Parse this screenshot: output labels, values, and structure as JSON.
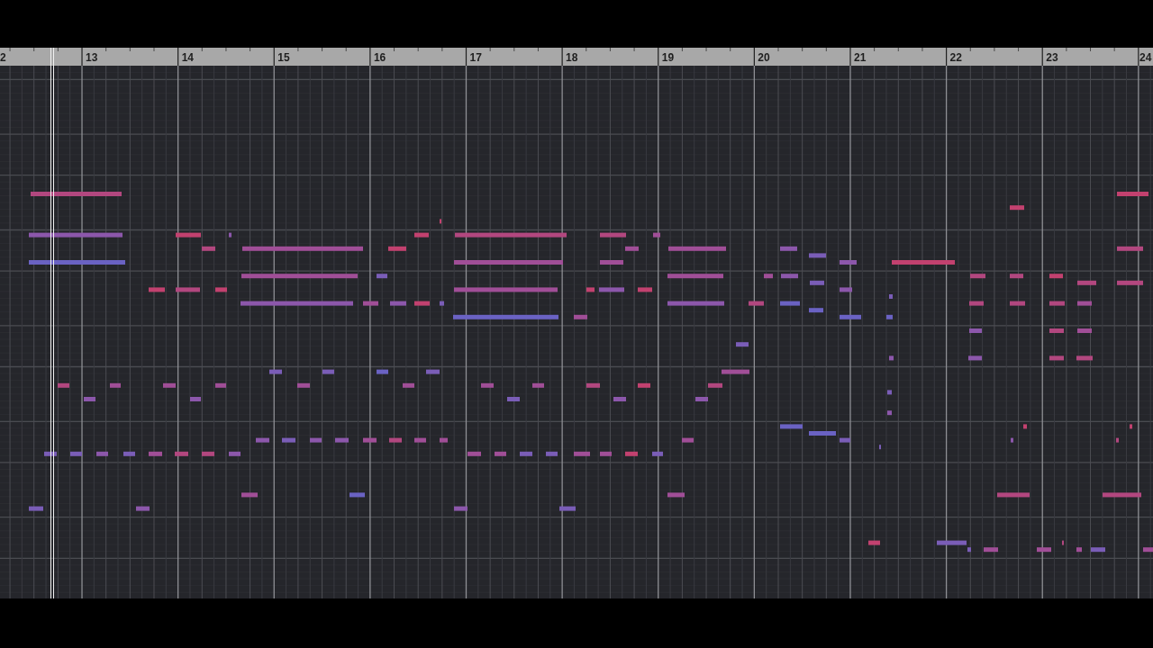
{
  "ruler": {
    "bar_numbers": [
      "2",
      "13",
      "14",
      "15",
      "16",
      "17",
      "18",
      "19",
      "20",
      "21",
      "22",
      "23",
      "24"
    ]
  },
  "notes": [
    {
      "color": "#b2477f"
    },
    {
      "color": "#8c57ab"
    },
    {
      "color": "#6a62c3"
    },
    {
      "color": "#c2416f"
    },
    {
      "color": "#8c57ab"
    },
    {
      "color": "#b2477f"
    },
    {
      "color": "#a04e97"
    },
    {
      "color": "#a04e97"
    },
    {
      "color": "#7a5db7"
    },
    {
      "color": "#c2416f"
    },
    {
      "color": "#b2477f"
    },
    {
      "color": "#c2416f"
    },
    {
      "color": "#8c57ab"
    },
    {
      "color": "#a04e97"
    },
    {
      "color": "#c2416f"
    },
    {
      "color": "#c2416f"
    },
    {
      "color": "#b2477f"
    },
    {
      "color": "#b2477f"
    },
    {
      "color": "#a04e97"
    },
    {
      "color": "#c2416f"
    },
    {
      "color": "#a04e97"
    },
    {
      "color": "#a04e97"
    },
    {
      "color": "#a04e97"
    },
    {
      "color": "#a04e97"
    },
    {
      "color": "#a04e97"
    },
    {
      "color": "#a04e97"
    },
    {
      "color": "#a04e97"
    },
    {
      "color": "#c2416f"
    },
    {
      "color": "#8c57ab"
    },
    {
      "color": "#c2416f"
    },
    {
      "color": "#8c57ab"
    },
    {
      "color": "#c2416f"
    },
    {
      "color": "#7a5db7"
    },
    {
      "color": "#8c57ab"
    },
    {
      "color": "#b2477f"
    },
    {
      "color": "#c2416f"
    },
    {
      "color": "#c2416f"
    },
    {
      "color": "#8c57ab"
    },
    {
      "color": "#b2477f"
    },
    {
      "color": "#7a5db7"
    },
    {
      "color": "#8c57ab"
    },
    {
      "color": "#c2416f"
    },
    {
      "color": "#8c57ab"
    },
    {
      "color": "#b2477f"
    },
    {
      "color": "#b2477f"
    },
    {
      "color": "#c2416f"
    },
    {
      "color": "#7a5db7"
    },
    {
      "color": "#b2477f"
    },
    {
      "color": "#b2477f"
    },
    {
      "color": "#8c57ab"
    },
    {
      "color": "#7a5db7"
    },
    {
      "color": "#6a62c3"
    },
    {
      "color": "#b2477f"
    },
    {
      "color": "#b2477f"
    },
    {
      "color": "#b2477f"
    },
    {
      "color": "#a04e97"
    },
    {
      "color": "#6a62c3"
    },
    {
      "color": "#7a5db7"
    },
    {
      "color": "#7a5db7"
    },
    {
      "color": "#6a62c3"
    },
    {
      "color": "#b2477f"
    },
    {
      "color": "#a04e97"
    },
    {
      "color": "#a04e97"
    },
    {
      "color": "#a04e97"
    },
    {
      "color": "#a04e97"
    },
    {
      "color": "#8c57ab"
    },
    {
      "color": "#8c57ab"
    },
    {
      "color": "#8c57ab"
    },
    {
      "color": "#7a5db7"
    },
    {
      "color": "#8c57ab"
    },
    {
      "color": "#8c57ab"
    },
    {
      "color": "#a04e97"
    },
    {
      "color": "#7a5db7"
    },
    {
      "color": "#7a5db7"
    },
    {
      "color": "#8c57ab"
    },
    {
      "color": "#7a5db7"
    },
    {
      "color": "#a04e97"
    },
    {
      "color": "#b2477f"
    },
    {
      "color": "#b2477f"
    },
    {
      "color": "#8c57ab"
    },
    {
      "color": "#a04e97"
    },
    {
      "color": "#6a62c3"
    },
    {
      "color": "#7a5db7"
    },
    {
      "color": "#8c57ab"
    },
    {
      "color": "#6a62c3"
    },
    {
      "color": "#a04e97"
    },
    {
      "color": "#7a5db7"
    },
    {
      "color": "#7a5db7"
    },
    {
      "color": "#a04e97"
    },
    {
      "color": "#a04e97"
    },
    {
      "color": "#a04e97"
    },
    {
      "color": "#a04e97"
    },
    {
      "color": "#b2477f"
    },
    {
      "color": "#c2416f"
    },
    {
      "color": "#b2477f"
    },
    {
      "color": "#7a5db7"
    },
    {
      "color": "#8c57ab"
    },
    {
      "color": "#8c57ab"
    },
    {
      "color": "#b2477f"
    },
    {
      "color": "#a04e97"
    },
    {
      "color": "#a04e97"
    },
    {
      "color": "#a04e97"
    },
    {
      "color": "#a04e97"
    },
    {
      "color": "#a04e97"
    },
    {
      "color": "#7a5db7"
    },
    {
      "color": "#7a5db7"
    },
    {
      "color": "#a04e97"
    },
    {
      "color": "#a04e97"
    },
    {
      "color": "#c2416f"
    },
    {
      "color": "#7a5db7"
    },
    {
      "color": "#a04e97"
    },
    {
      "color": "#8c57ab"
    },
    {
      "color": "#7a5db7"
    },
    {
      "color": "#6a62c3"
    },
    {
      "color": "#6a62c3"
    },
    {
      "color": "#8c57ab"
    },
    {
      "color": "#b2477f"
    },
    {
      "color": "#a04e97"
    },
    {
      "color": "#8c57ab"
    },
    {
      "color": "#8c57ab"
    },
    {
      "color": "#b2477f"
    },
    {
      "color": "#b2477f"
    },
    {
      "color": "#7a5db7"
    },
    {
      "color": "#8c57ab"
    },
    {
      "color": "#6a62c3"
    },
    {
      "color": "#c2416f"
    },
    {
      "color": "#c2416f"
    },
    {
      "color": "#6a62c3"
    },
    {
      "color": "#7a5db7"
    },
    {
      "color": "#8c57ab"
    },
    {
      "color": "#b2477f"
    },
    {
      "color": "#7a5db7"
    },
    {
      "color": "#b2477f"
    },
    {
      "color": "#b2477f"
    },
    {
      "color": "#c2416f"
    },
    {
      "color": "#7a5db7"
    },
    {
      "color": "#b2477f"
    },
    {
      "color": "#7a5db7"
    },
    {
      "color": "#a04e97"
    },
    {
      "color": "#a04e97"
    },
    {
      "color": "#a04e97"
    },
    {
      "color": "#7a5db7"
    },
    {
      "color": "#a04e97"
    }
  ]
}
